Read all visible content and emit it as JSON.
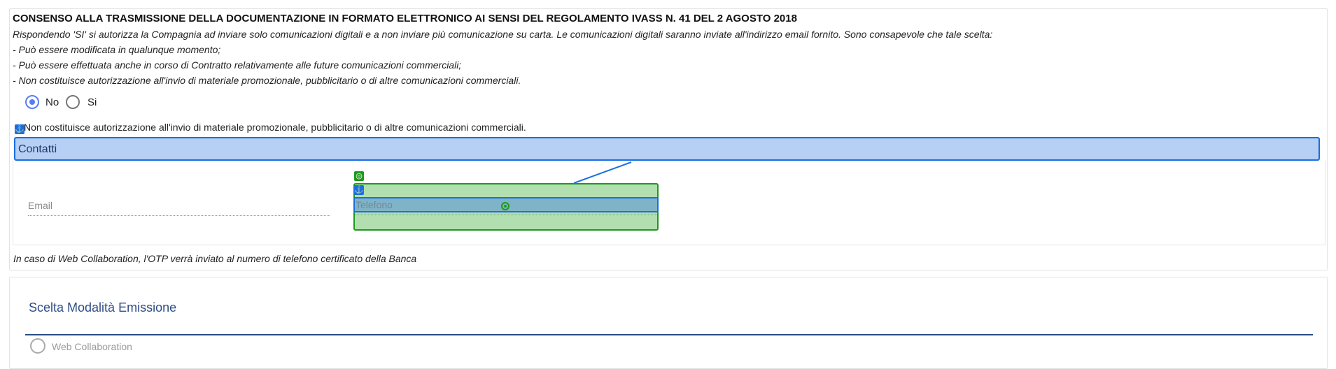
{
  "consent": {
    "title": "CONSENSO ALLA TRASMISSIONE DELLA DOCUMENTAZIONE IN FORMATO ELETTRONICO AI SENSI DEL REGOLAMENTO IVASS N. 41 DEL 2 AGOSTO 2018",
    "lines": [
      "Rispondendo 'SI' si autorizza la Compagnia ad inviare solo comunicazioni digitali e a non inviare più comunicazione su carta. Le comunicazioni digitali saranno inviate all'indirizzo email fornito. Sono consapevole che tale scelta:",
      "- Può essere modificata in qualunque momento;",
      "- Può essere effettuata anche in corso di Contratto relativamente alle future comunicazioni commerciali;",
      "- Non costituisce autorizzazione all'invio di materiale promozionale, pubblicitario o di altre comunicazioni commerciali."
    ],
    "options": [
      {
        "label": "No",
        "selected": true
      },
      {
        "label": "Si",
        "selected": false
      }
    ],
    "repeated_line": "Non costituisce autorizzazione all'invio di materiale promozionale, pubblicitario o di altre comunicazioni commerciali."
  },
  "contacts": {
    "header": "Contatti",
    "email_label": "Email",
    "phone_label": "Telefono",
    "note": "In caso di Web Collaboration, l'OTP verrà inviato al numero di telefono certificato della Banca"
  },
  "editor_overlay": {
    "anchor_icon": "anchor-icon",
    "target_icon": "target-icon",
    "anchor_color": "#1a6fe0",
    "target_color": "#1d9a1d"
  },
  "emission": {
    "title": "Scelta Modalità Emissione",
    "option_label": "Web Collaboration"
  }
}
